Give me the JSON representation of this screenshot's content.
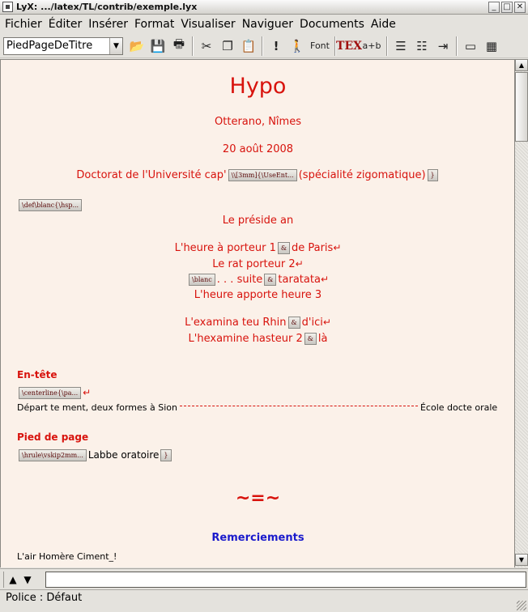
{
  "window": {
    "title": "LyX: .../latex/TL/contrib/exemple.lyx"
  },
  "menubar": {
    "items": [
      "Fichier",
      "Éditer",
      "Insérer",
      "Format",
      "Visualiser",
      "Naviguer",
      "Documents",
      "Aide"
    ]
  },
  "toolbar": {
    "layout_select": "PiedPageDeTitre",
    "font_label": "Font",
    "tex_label": "TEX",
    "math_label": "a+b"
  },
  "document": {
    "title": "Hypo",
    "author": "Otterano, Nîmes",
    "date": "20 août 2008",
    "doctorat_before": "Doctorat de l'Université cap'",
    "doctorat_inset": "\\\\[3mm]{\\UseEnt...",
    "doctorat_after": "(spécialité zigomatique)",
    "brace_close": "}",
    "def_inset": "\\def\\blanc{\\hsp...",
    "preside": "Le préside an",
    "verse1_a": "L'heure à porteur 1",
    "amp": "&",
    "verse1_b": "de Paris",
    "verse2": "Le rat porteur 2",
    "blanc_inset": "\\blanc",
    "verse3_a": ". . . suite",
    "verse3_b": "taratata",
    "verse4": "L'heure apporte heure 3",
    "verse5_a": "L'examina teu Rhin",
    "verse5_b": "d'ici",
    "verse6_a": "L'hexamine hasteur 2",
    "verse6_b": "là",
    "entete_label": "En-tête",
    "centerline_inset": "\\centerline{\\pa...",
    "header_left": "Départ te ment, deux formes à Sion",
    "header_right": "École docte orale",
    "pied_label": "Pied de page",
    "hrule_inset": "\\hrule\\vskip2mm...",
    "pied_text": "Labbe oratoire",
    "separator": "~=~",
    "remerciements": "Remerciements",
    "last_line": "L'air Homère Ciment_!"
  },
  "statusbar": {
    "text": "Police : Défaut"
  },
  "colors": {
    "red_text": "#d8130d",
    "blue_heading": "#1a1acc",
    "doc_bg": "#fbf1e9"
  }
}
